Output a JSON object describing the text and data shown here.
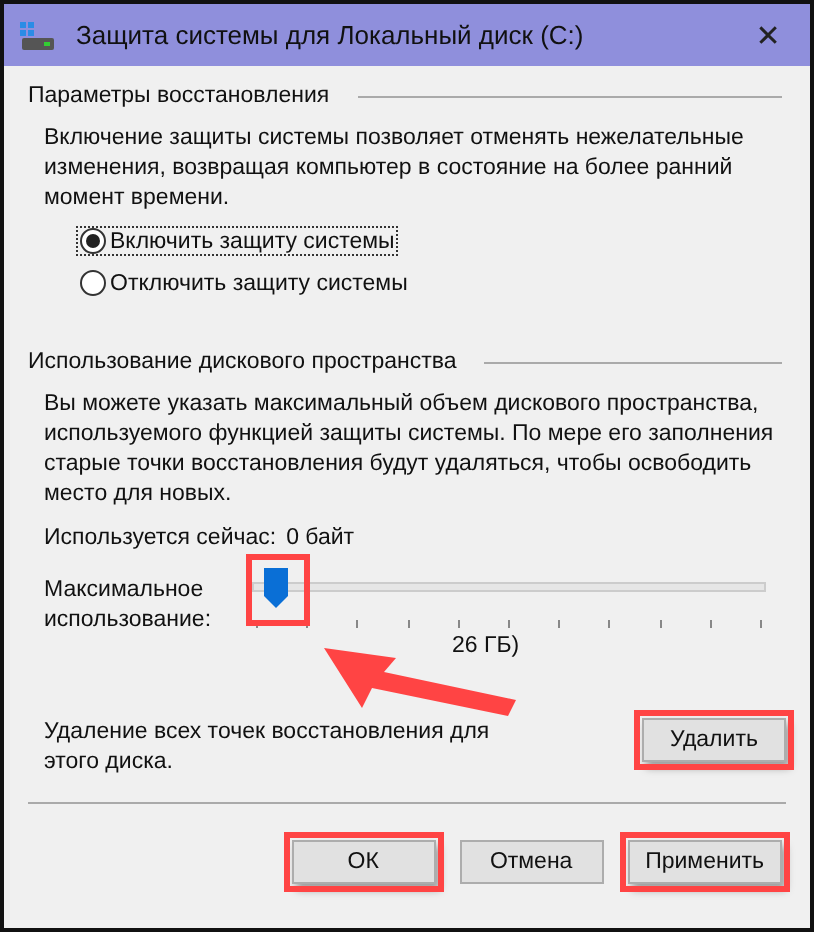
{
  "window": {
    "title": "Защита системы для Локальный диск (C:)",
    "close": "✕"
  },
  "restore_settings": {
    "heading": "Параметры восстановления",
    "description": "Включение защиты системы позволяет отменять нежелательные изменения, возвращая компьютер в состояние на более ранний момент времени.",
    "options": [
      {
        "label": "Включить защиту системы",
        "selected": true
      },
      {
        "label": "Отключить защиту системы",
        "selected": false
      }
    ]
  },
  "disk_usage": {
    "heading": "Использование дискового пространства",
    "description": "Вы можете указать максимальный объем дискового пространства, используемого функцией защиты системы. По мере его заполнения старые точки восстановления будут удаляться, чтобы освободить место для новых.",
    "current_usage_label": "Используется сейчас:",
    "current_usage_value": "0 байт",
    "max_usage": {
      "label": "Максимальное использование:",
      "level": 0.02,
      "highlighted": true,
      "reading": "26 ГБ)"
    },
    "delete_text": "Удаление всех точек восстановления для этого диска.",
    "delete_button": {
      "label": "Удалить",
      "highlighted": true
    }
  },
  "buttons": [
    {
      "label": "ОК",
      "highlighted": true
    },
    {
      "label": "Отмена",
      "highlighted": false
    },
    {
      "label": "Применить",
      "highlighted": true
    }
  ]
}
